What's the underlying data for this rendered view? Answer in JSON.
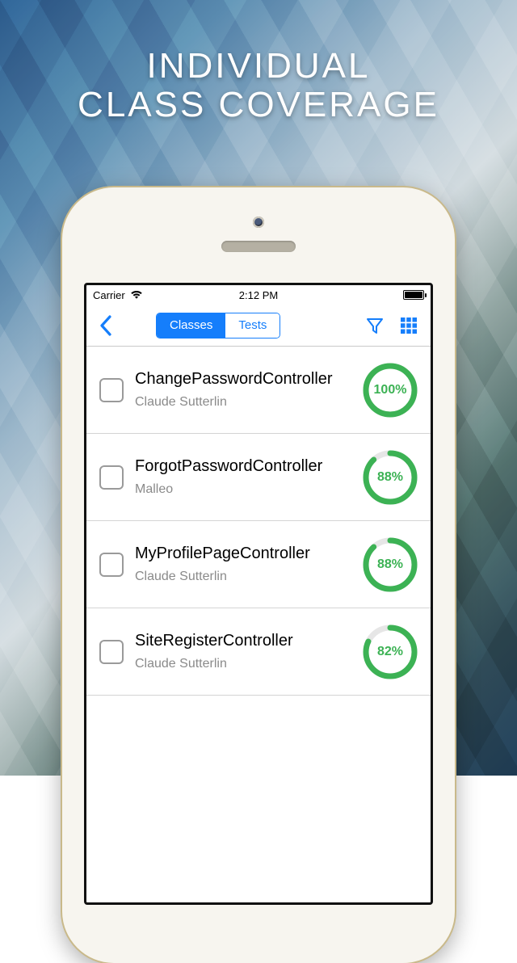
{
  "headline_line1": "INDIVIDUAL",
  "headline_line2": "CLASS COVERAGE",
  "statusbar": {
    "carrier": "Carrier",
    "time": "2:12 PM"
  },
  "navbar": {
    "segments": {
      "classes": "Classes",
      "tests": "Tests"
    },
    "active_segment": "classes"
  },
  "colors": {
    "accent": "#157efb",
    "ring_green": "#3cb254",
    "ring_track": "#e6e6e6"
  },
  "rows": [
    {
      "title": "ChangePasswordController",
      "author": "Claude Sutterlin",
      "percent": 100
    },
    {
      "title": "ForgotPasswordController",
      "author": "Malleo",
      "percent": 88
    },
    {
      "title": "MyProfilePageController",
      "author": "Claude Sutterlin",
      "percent": 88
    },
    {
      "title": "SiteRegisterController",
      "author": "Claude Sutterlin",
      "percent": 82
    }
  ]
}
